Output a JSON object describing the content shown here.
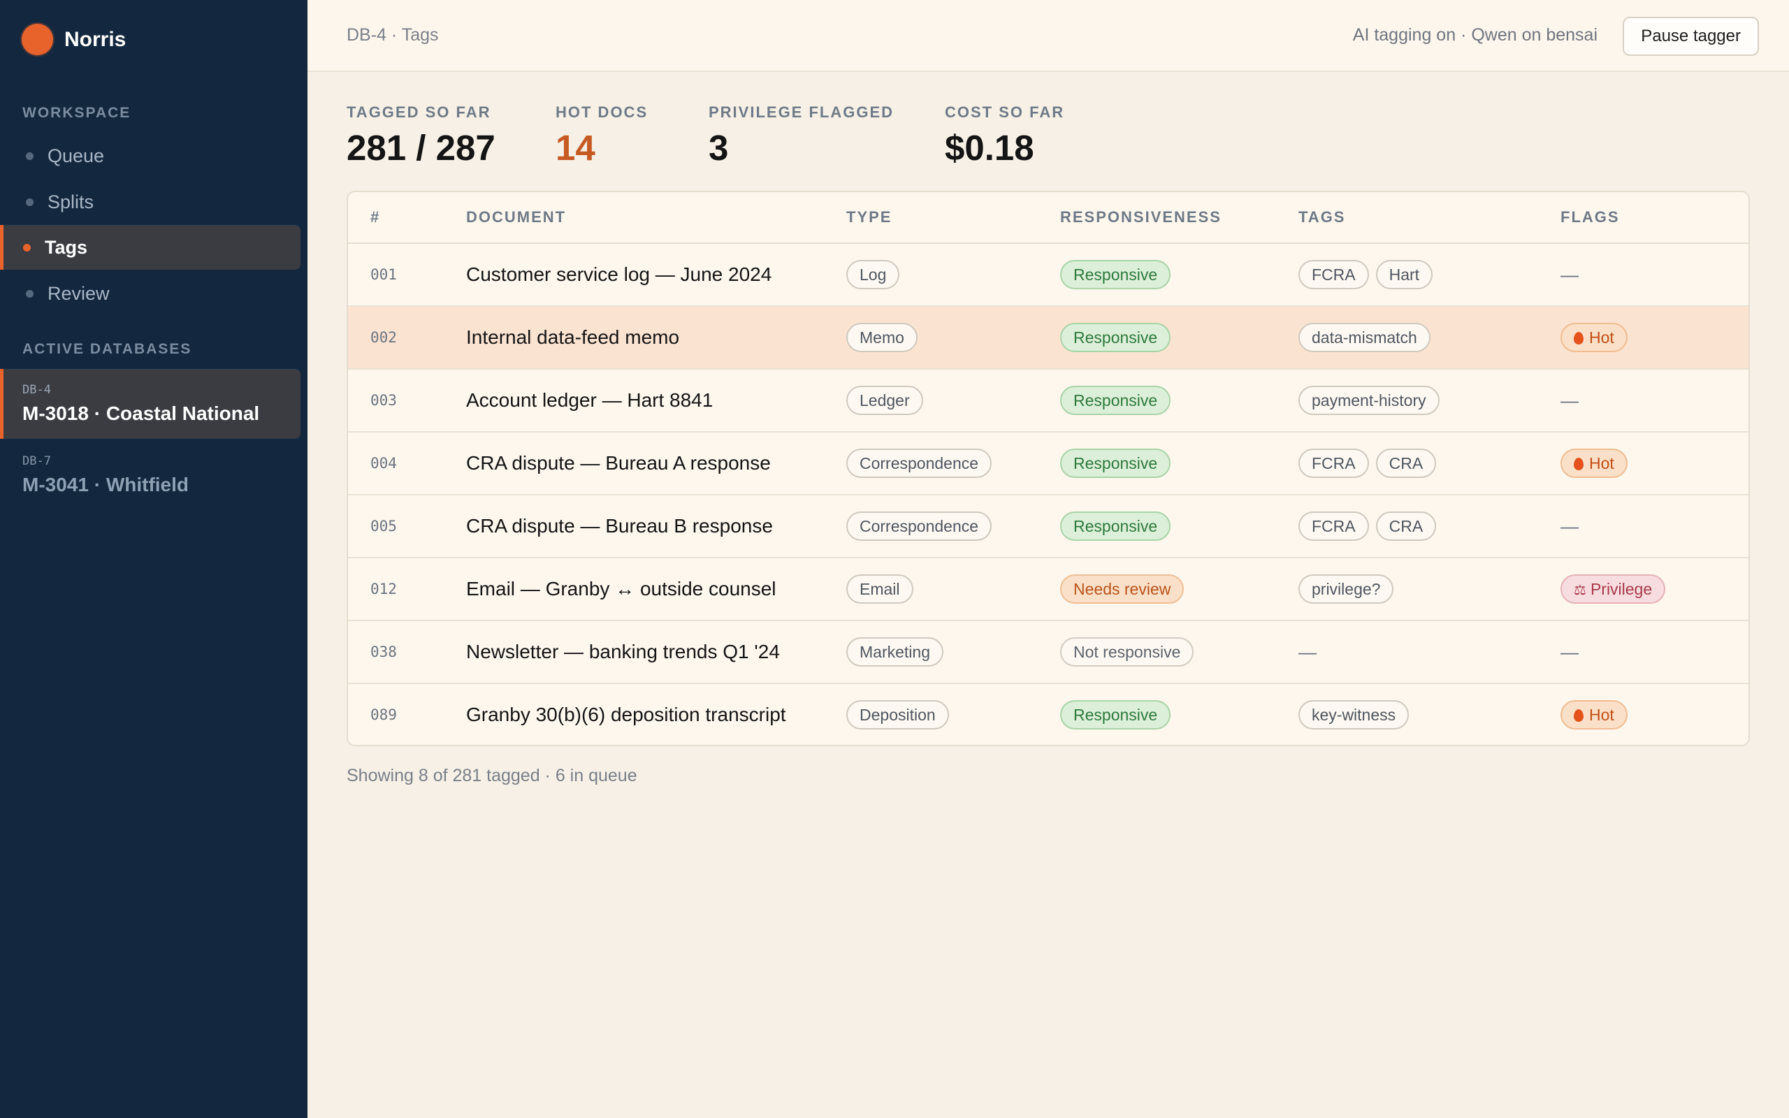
{
  "brand": {
    "name": "Norris",
    "color": "#e8622c"
  },
  "sidebar": {
    "workspace_label": "WORKSPACE",
    "nav": [
      {
        "label": "Queue",
        "active": false
      },
      {
        "label": "Splits",
        "active": false
      },
      {
        "label": "Tags",
        "active": true
      },
      {
        "label": "Review",
        "active": false
      }
    ],
    "databases_label": "ACTIVE DATABASES",
    "databases": [
      {
        "code": "DB-4",
        "name": "M-3018 · Coastal National",
        "active": true
      },
      {
        "code": "DB-7",
        "name": "M-3041 · Whitfield",
        "active": false
      }
    ]
  },
  "header": {
    "breadcrumb": "DB-4 · Tags",
    "ai_status": "AI tagging on · Qwen on bensai",
    "pause_label": "Pause tagger"
  },
  "stats": [
    {
      "label": "TAGGED SO FAR",
      "value": "281 / 287"
    },
    {
      "label": "HOT DOCS",
      "value": "14"
    },
    {
      "label": "PRIVILEGE FLAGGED",
      "value": "3"
    },
    {
      "label": "COST SO FAR",
      "value": "$0.18"
    }
  ],
  "table": {
    "columns": [
      "#",
      "DOCUMENT",
      "TYPE",
      "RESPONSIVENESS",
      "TAGS",
      "FLAGS"
    ],
    "rows": [
      {
        "num": "001",
        "doc": "Customer service log — June 2024",
        "type": "Log",
        "resp": "Responsive",
        "tags": [
          "FCRA",
          "Hart"
        ],
        "flag": "—"
      },
      {
        "num": "002",
        "doc": "Internal data-feed memo",
        "type": "Memo",
        "resp": "Responsive",
        "tags": [
          "data-mismatch"
        ],
        "flag": "Hot"
      },
      {
        "num": "003",
        "doc": "Account ledger — Hart 8841",
        "type": "Ledger",
        "resp": "Responsive",
        "tags": [
          "payment-history"
        ],
        "flag": "—"
      },
      {
        "num": "004",
        "doc": "CRA dispute — Bureau A response",
        "type": "Correspondence",
        "resp": "Responsive",
        "tags": [
          "FCRA",
          "CRA"
        ],
        "flag": "Hot"
      },
      {
        "num": "005",
        "doc": "CRA dispute — Bureau B response",
        "type": "Correspondence",
        "resp": "Responsive",
        "tags": [
          "FCRA",
          "CRA"
        ],
        "flag": "—"
      },
      {
        "num": "012",
        "doc": "Email — Granby ↔ outside counsel",
        "type": "Email",
        "resp": "Needs review",
        "tags": [
          "privilege?"
        ],
        "flag": "Privilege"
      },
      {
        "num": "038",
        "doc": "Newsletter — banking trends Q1 '24",
        "type": "Marketing",
        "resp": "Not responsive",
        "tags": [
          "—"
        ],
        "flag": "—"
      },
      {
        "num": "089",
        "doc": "Granby 30(b)(6) deposition transcript",
        "type": "Deposition",
        "resp": "Responsive",
        "tags": [
          "key-witness"
        ],
        "flag": "Hot"
      }
    ]
  },
  "footer": {
    "text": "Showing 8 of 281 tagged · 6 in queue"
  }
}
